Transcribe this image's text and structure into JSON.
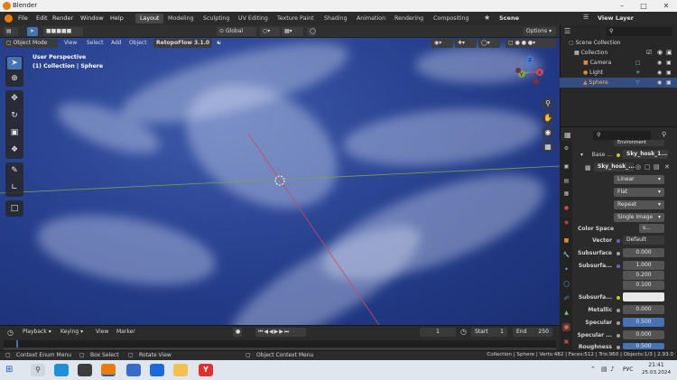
{
  "window": {
    "title": "Blender"
  },
  "menu": {
    "items": [
      "File",
      "Edit",
      "Render",
      "Window",
      "Help"
    ],
    "workspaces": [
      "Layout",
      "Modeling",
      "Sculpting",
      "UV Editing",
      "Texture Paint",
      "Shading",
      "Animation",
      "Rendering",
      "Compositing"
    ],
    "active_workspace": "Layout",
    "scene": "Scene",
    "view_layer": "View Layer"
  },
  "header": {
    "transform_orientation": "Global",
    "options": "Options",
    "mode": "Object Mode",
    "menus": [
      "View",
      "Select",
      "Add",
      "Object"
    ],
    "addon": "RetopoFlow 3.1.0"
  },
  "viewport": {
    "perspective_label": "User Perspective",
    "collection_label": "(1) Collection | Sphere",
    "gizmo_axes": {
      "x": "X",
      "y": "Y",
      "z": "Z"
    },
    "colors": {
      "sky_dark": "#1b2f72",
      "sky_light": "#3d5aa8",
      "x_axis": "#d0485d",
      "y_axis": "#7fa04b"
    }
  },
  "outliner": {
    "header": "Scene Collection",
    "rows": [
      {
        "name": "Collection",
        "icon": "collection-icon"
      },
      {
        "name": "Camera",
        "icon": "camera-icon"
      },
      {
        "name": "Light",
        "icon": "light-icon"
      },
      {
        "name": "Sphere",
        "icon": "mesh-icon",
        "selected": true
      }
    ]
  },
  "properties": {
    "truncated_top": "Environment",
    "base_label": "Base ...",
    "base_value": "Sky_hosk_1...",
    "image_name": "Sky_hosk_...",
    "interpolation": "Linear",
    "projection": "Flat",
    "extension": "Repeat",
    "source": "Single Image",
    "color_space_label": "Color Space",
    "color_space_value": "s...",
    "vector_label": "Vector",
    "vector_value": "Default",
    "rows": [
      {
        "label": "Subsurface",
        "value": "0.000"
      },
      {
        "label": "Subsurfa...",
        "values": [
          "1.000",
          "0.200",
          "0.100"
        ]
      },
      {
        "label": "Subsurfa...",
        "value": ""
      },
      {
        "label": "Metallic",
        "value": "0.000"
      },
      {
        "label": "Specular",
        "value": "0.500"
      },
      {
        "label": "Specular ...",
        "value": "0.000"
      },
      {
        "label": "Roughness",
        "value": "0.500"
      }
    ]
  },
  "timeline": {
    "menus": [
      "Playback",
      "Keying",
      "View",
      "Marker"
    ],
    "current_frame": "1",
    "start_label": "Start",
    "start": "1",
    "end_label": "End",
    "end": "250"
  },
  "statusbar": {
    "items": [
      "Context Enum Menu",
      "Box Select",
      "Rotate View",
      "Object Context Menu"
    ],
    "stats": "Collection | Sphere | Verts:482 | Faces:512 | Tris:960 | Objects:1/3 | 2.93.0"
  },
  "taskbar": {
    "language": "РУС",
    "time": "21:41",
    "date": "25.03.2024"
  }
}
